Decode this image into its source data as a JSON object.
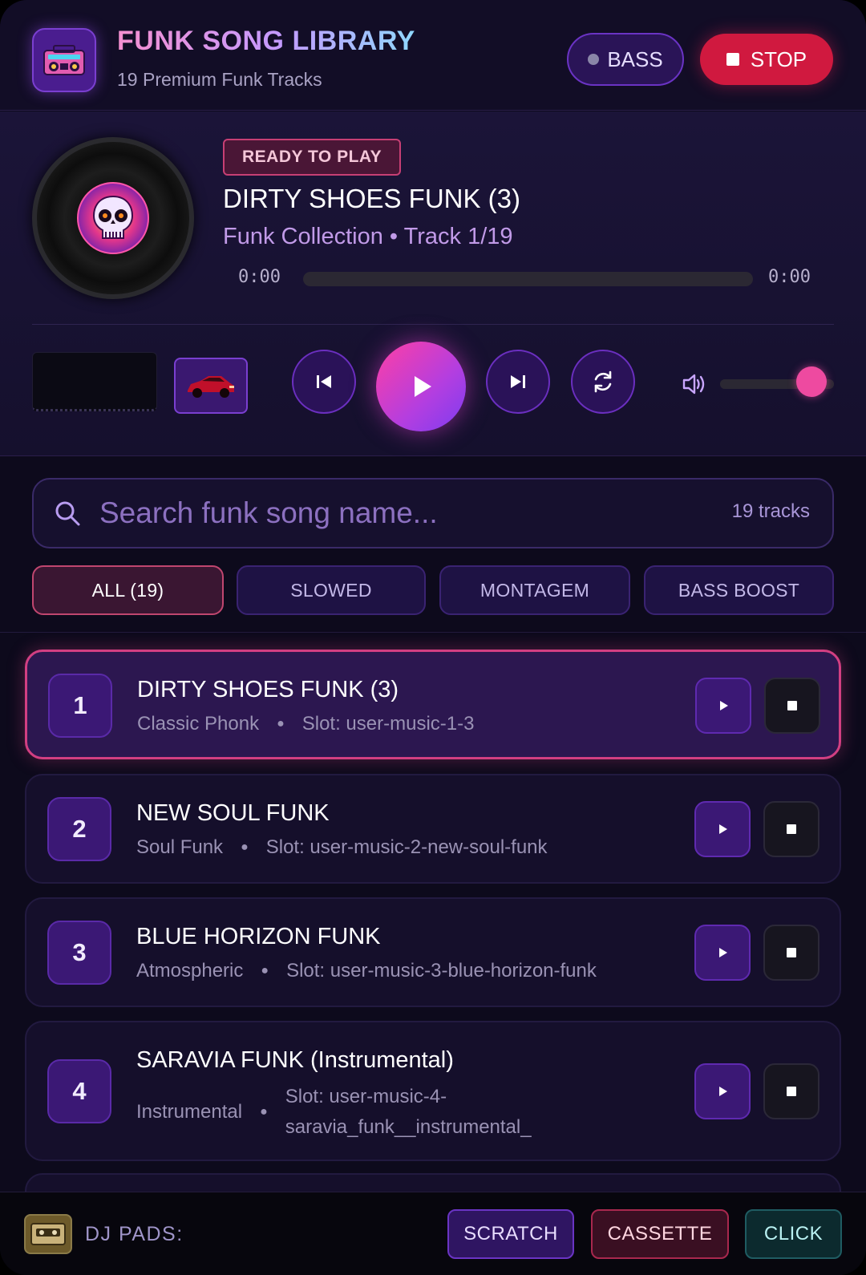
{
  "header": {
    "title": "FUNK SONG LIBRARY",
    "subtitle": "19 Premium Funk Tracks",
    "bass_label": "BASS",
    "stop_label": "STOP"
  },
  "player": {
    "status_badge": "READY TO PLAY",
    "title": "DIRTY SHOES FUNK (3)",
    "subtitle": "Funk Collection • Track 1/19",
    "time_current": "0:00",
    "time_total": "0:00",
    "progress": 0,
    "volume": 0.8
  },
  "search": {
    "placeholder": "Search funk song name...",
    "count_label": "19 tracks"
  },
  "filters": [
    {
      "label": "ALL (19)",
      "active": true
    },
    {
      "label": "SLOWED",
      "active": false
    },
    {
      "label": "MONTAGEM",
      "active": false
    },
    {
      "label": "BASS BOOST",
      "active": false
    }
  ],
  "tracks": [
    {
      "number": "1",
      "title": "DIRTY SHOES FUNK (3)",
      "genre": "Classic Phonk",
      "slot": "Slot: user-music-1-3",
      "active": true
    },
    {
      "number": "2",
      "title": "NEW SOUL FUNK",
      "genre": "Soul Funk",
      "slot": "Slot: user-music-2-new-soul-funk",
      "active": false
    },
    {
      "number": "3",
      "title": "BLUE HORIZON FUNK",
      "genre": "Atmospheric",
      "slot": "Slot: user-music-3-blue-horizon-funk",
      "active": false
    },
    {
      "number": "4",
      "title": "SARAVIA FUNK (Instrumental)",
      "genre": "Instrumental",
      "slot": "Slot: user-music-4-saravia_funk__instrumental_",
      "active": false
    }
  ],
  "dj_pads": {
    "label": "DJ PADS:",
    "scratch": "SCRATCH",
    "cassette": "CASSETTE",
    "click": "CLICK"
  },
  "colors": {
    "accent_pink": "#e23fb0",
    "accent_purple": "#7d3cf0",
    "stop_red": "#d0193f"
  }
}
